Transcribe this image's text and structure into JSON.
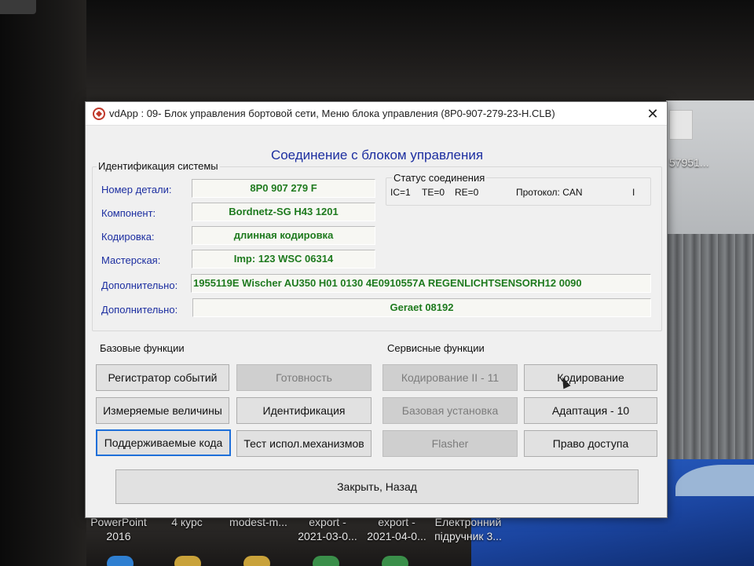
{
  "window": {
    "title": "vdApp : 09- Блок управления бортовой сети,  Меню блока управления (8P0-907-279-23-H.CLB)",
    "close_icon": "close-icon",
    "heading": "Соединение с блоком управления"
  },
  "identification": {
    "section_label": "Идентификация системы",
    "fields": [
      {
        "label": "Номер детали:",
        "value": "8P0 907 279 F"
      },
      {
        "label": "Компонент:",
        "value": "Bordnetz-SG     H43 1201"
      },
      {
        "label": "Кодировка:",
        "value": "длинная кодировка"
      },
      {
        "label": "Мастерская:",
        "value": "Imp: 123     WSC 06314"
      },
      {
        "label": "Дополнительно:",
        "value": "1955119E  Wischer AU350    H01 0130    4E0910557A  REGENLICHTSENSORH12 0090"
      },
      {
        "label": "Дополнительно:",
        "value": "Geraet 08192"
      }
    ]
  },
  "connection_status": {
    "section_label": "Статус соединения",
    "ic": "IC=1",
    "te": "TE=0",
    "re": "RE=0",
    "protocol": "Протокол: CAN",
    "extra": "I"
  },
  "basic_functions": {
    "section_label": "Базовые функции",
    "buttons": [
      {
        "label": "Регистратор событий",
        "enabled": true
      },
      {
        "label": "Готовность",
        "enabled": false
      },
      {
        "label": "Измеряемые величины",
        "enabled": true
      },
      {
        "label": "Идентификация",
        "enabled": true
      },
      {
        "label": "Поддерживаемые кода",
        "enabled": true
      },
      {
        "label": "Тест испол.механизмов",
        "enabled": true
      }
    ]
  },
  "service_functions": {
    "section_label": "Сервисные функции",
    "buttons": [
      {
        "label": "Кодирование II - 11",
        "enabled": false
      },
      {
        "label": "Кодирование",
        "enabled": true
      },
      {
        "label": "Базовая установка",
        "enabled": false
      },
      {
        "label": "Адаптация - 10",
        "enabled": true
      },
      {
        "label": "Flasher",
        "enabled": false
      },
      {
        "label": "Право доступа",
        "enabled": true
      }
    ]
  },
  "close_button": {
    "label": "Закрыть, Назад"
  },
  "desktop": {
    "top_right_label": "57951...",
    "icons": [
      {
        "line1": "PowerPoint",
        "line2": "2016"
      },
      {
        "line1": "4 курс",
        "line2": ""
      },
      {
        "line1": "modest-m...",
        "line2": ""
      },
      {
        "line1": "export -",
        "line2": "2021-03-0..."
      },
      {
        "line1": "export -",
        "line2": "2021-04-0..."
      },
      {
        "line1": "Електронний",
        "line2": "підручник 3..."
      }
    ]
  },
  "colors": {
    "heading": "#1c2ea0",
    "field_label": "#1c2ea0",
    "field_value": "#1e7a1e",
    "focus": "#1e6fd9"
  }
}
